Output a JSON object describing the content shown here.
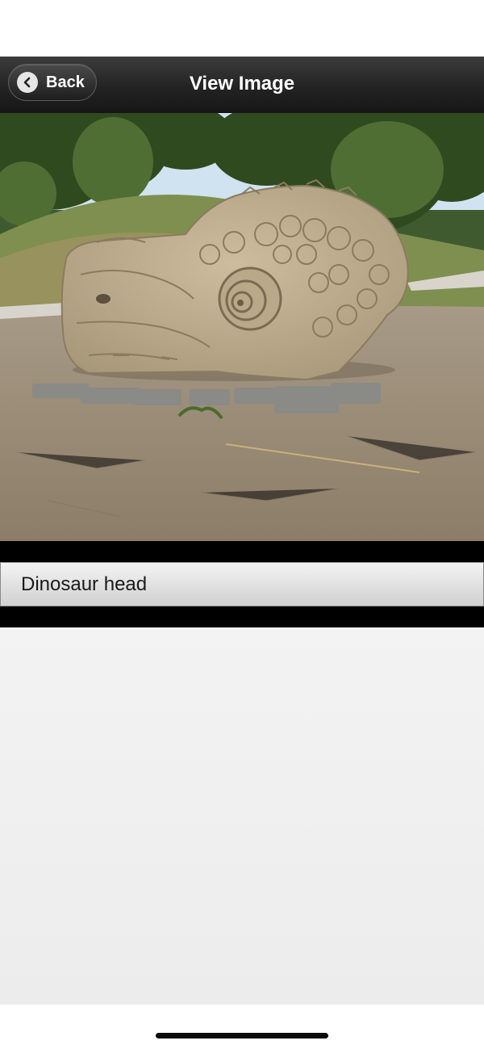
{
  "header": {
    "back_label": "Back",
    "title": "View Image"
  },
  "image": {
    "subject": "stone dinosaur head sculpture"
  },
  "caption": {
    "text": "Dinosaur head"
  },
  "colors": {
    "header_bg": "#232323",
    "photo_band": "#000000",
    "content_bg": "#eeeeee"
  }
}
